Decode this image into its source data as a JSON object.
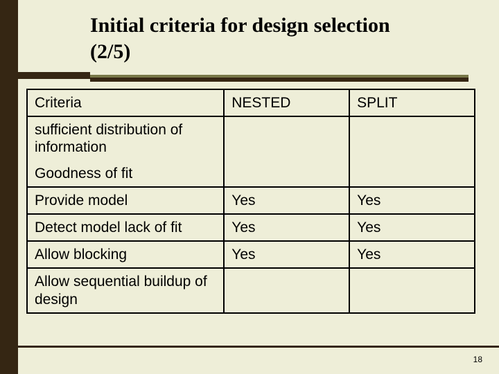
{
  "title_line1": "Initial criteria for design selection",
  "title_line2": "(2/5)",
  "page_number": "18",
  "chart_data": {
    "type": "table",
    "columns": [
      "Criteria",
      "NESTED",
      "SPLIT"
    ],
    "rows": [
      {
        "criteria": "sufficient distribution of information",
        "nested": "",
        "split": ""
      },
      {
        "criteria": "Goodness of fit",
        "nested": "",
        "split": ""
      },
      {
        "criteria": "Provide model",
        "nested": "Yes",
        "split": "Yes"
      },
      {
        "criteria": "Detect model lack of fit",
        "nested": "Yes",
        "split": "Yes"
      },
      {
        "criteria": "Allow blocking",
        "nested": "Yes",
        "split": "Yes"
      },
      {
        "criteria": "Allow sequential buildup of design",
        "nested": "",
        "split": ""
      }
    ]
  }
}
